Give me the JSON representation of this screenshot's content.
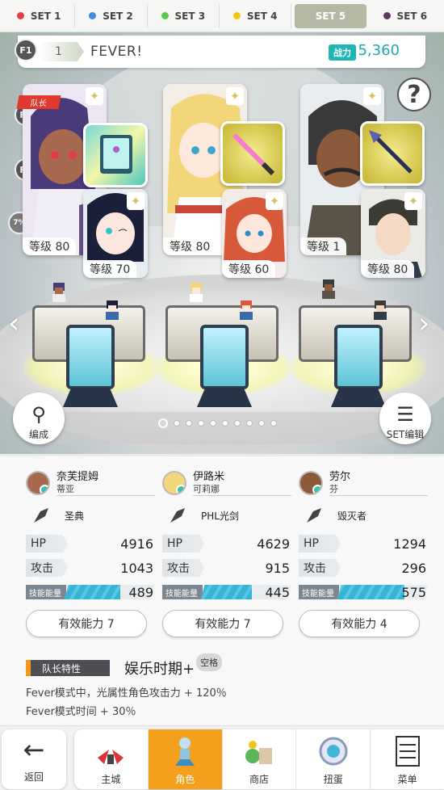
{
  "set_tabs": [
    {
      "label": "SET 1",
      "color": "#e23d4a"
    },
    {
      "label": "SET 2",
      "color": "#3a8de0"
    },
    {
      "label": "SET 3",
      "color": "#5ac84a"
    },
    {
      "label": "SET 4",
      "color": "#f1c617"
    },
    {
      "label": "SET 5",
      "color": "#b3b9a2",
      "active": true
    },
    {
      "label": "SET 6",
      "color": "#5a3a5e"
    }
  ],
  "fever": {
    "num": "1",
    "label": "FEVER!",
    "power_label": "战力",
    "power_value": "5,360"
  },
  "side_floors": [
    "F1",
    "F2",
    "F3"
  ],
  "percent_bubble": "7%",
  "help_glyph": "?",
  "leader_ribbon": "队长",
  "cards": [
    {
      "main_level": "等级 80",
      "sub_level": "等级 70"
    },
    {
      "main_level": "等级 80",
      "sub_level": "等级 60"
    },
    {
      "main_level": "等级 1",
      "sub_level": "等级 80"
    }
  ],
  "buttons": {
    "formation": "编成",
    "set_edit": "SET编辑"
  },
  "characters": [
    {
      "name": "奈芙提姆",
      "sub": "蒂亚",
      "weapon": "圣典",
      "hp": "4916",
      "atk": "1043",
      "energy": "489",
      "energy_fraction": 0.62,
      "ability": "有效能力 7"
    },
    {
      "name": "伊路米",
      "sub": "可莉娜",
      "weapon": "PHL光剑",
      "hp": "4629",
      "atk": "915",
      "energy": "445",
      "energy_fraction": 0.56,
      "ability": "有效能力 7"
    },
    {
      "name": "劳尔",
      "sub": "芬",
      "weapon": "毁灭者",
      "hp": "1294",
      "atk": "296",
      "energy": "575",
      "energy_fraction": 0.74,
      "ability": "有效能力 4"
    }
  ],
  "stat_labels": {
    "hp": "HP",
    "atk": "攻击",
    "energy": "技能能量"
  },
  "leader": {
    "tag": "队长特性",
    "skill": "娱乐时期+",
    "badge": "空格",
    "desc1": "Fever模式中，光属性角色攻击力 + 120％",
    "desc2": "Fever模式时间 + 30％"
  },
  "nav": {
    "back": "返回",
    "items": [
      {
        "label": "主城",
        "icon": "castle-icon"
      },
      {
        "label": "角色",
        "icon": "character-icon",
        "active": true
      },
      {
        "label": "商店",
        "icon": "shop-icon"
      },
      {
        "label": "扭蛋",
        "icon": "gacha-icon"
      },
      {
        "label": "菜单",
        "icon": "menu-icon"
      }
    ]
  },
  "colors": {
    "accent": "#f5a01c",
    "teal": "#21b5b3",
    "energy": "#35b4d6"
  }
}
